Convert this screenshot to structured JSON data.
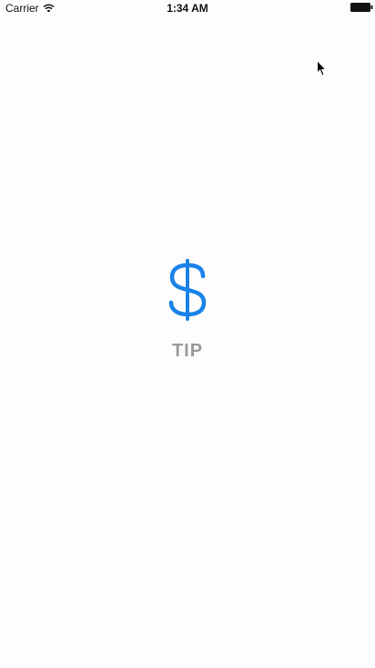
{
  "status_bar": {
    "carrier": "Carrier",
    "time": "1:34 AM",
    "wifi_icon": "wifi-icon",
    "battery_icon": "battery-full-icon"
  },
  "splash": {
    "icon": "dollar-sign-icon",
    "icon_color": "#1a82e8",
    "label": "TIP",
    "label_color": "#9a9a9e"
  }
}
